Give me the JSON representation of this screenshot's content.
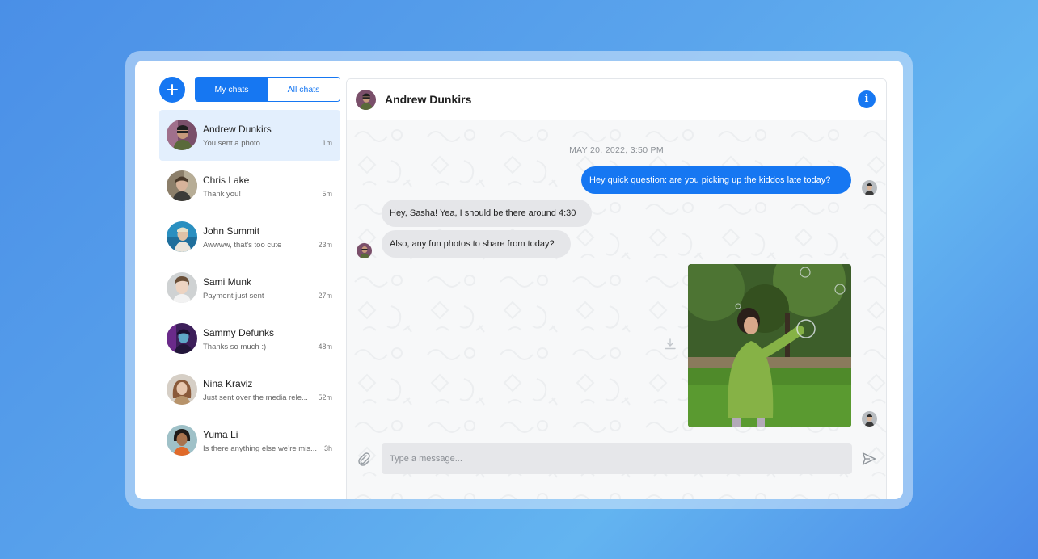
{
  "sidebar": {
    "new_chat_icon": "plus-icon",
    "tabs": [
      {
        "label": "My chats",
        "active": true
      },
      {
        "label": "All chats",
        "active": false
      }
    ],
    "chats": [
      {
        "name": "Andrew Dunkirs",
        "preview": "You sent a photo",
        "time": "1m",
        "selected": true
      },
      {
        "name": "Chris Lake",
        "preview": "Thank you!",
        "time": "5m",
        "selected": false
      },
      {
        "name": "John Summit",
        "preview": "Awwww, that’s too cute",
        "time": "23m",
        "selected": false
      },
      {
        "name": "Sami Munk",
        "preview": "Payment just sent",
        "time": "27m",
        "selected": false
      },
      {
        "name": "Sammy Defunks",
        "preview": "Thanks so much :)",
        "time": "48m",
        "selected": false
      },
      {
        "name": "Nina Kraviz",
        "preview": "Just sent over the media rele...",
        "time": "52m",
        "selected": false
      },
      {
        "name": "Yuma Li",
        "preview": "Is there anything else we’re mis...",
        "time": "3h",
        "selected": false
      }
    ]
  },
  "conversation": {
    "title": "Andrew Dunkirs",
    "info_icon": "info-icon",
    "date_separator": "MAY 20, 2022, 3:50 PM",
    "messages": [
      {
        "direction": "out",
        "text": "Hey quick question: are you picking up the kiddos late today?"
      },
      {
        "direction": "in",
        "text": "Hey, Sasha! Yea, I should be there around 4:30"
      },
      {
        "direction": "in",
        "text": "Also, any fun photos to share from today?"
      },
      {
        "direction": "out",
        "type": "photo",
        "alt": "Child in a green jacket reaching for soap bubbles in a park"
      }
    ],
    "composer": {
      "placeholder": "Type a message...",
      "attach_icon": "paperclip-icon",
      "send_icon": "send-icon"
    }
  },
  "colors": {
    "accent": "#1677f2",
    "selected_row": "#e3effd",
    "incoming_bubble": "#e5e6e9",
    "background_gradient": [
      "#4a8fe7",
      "#63b4f0"
    ]
  }
}
